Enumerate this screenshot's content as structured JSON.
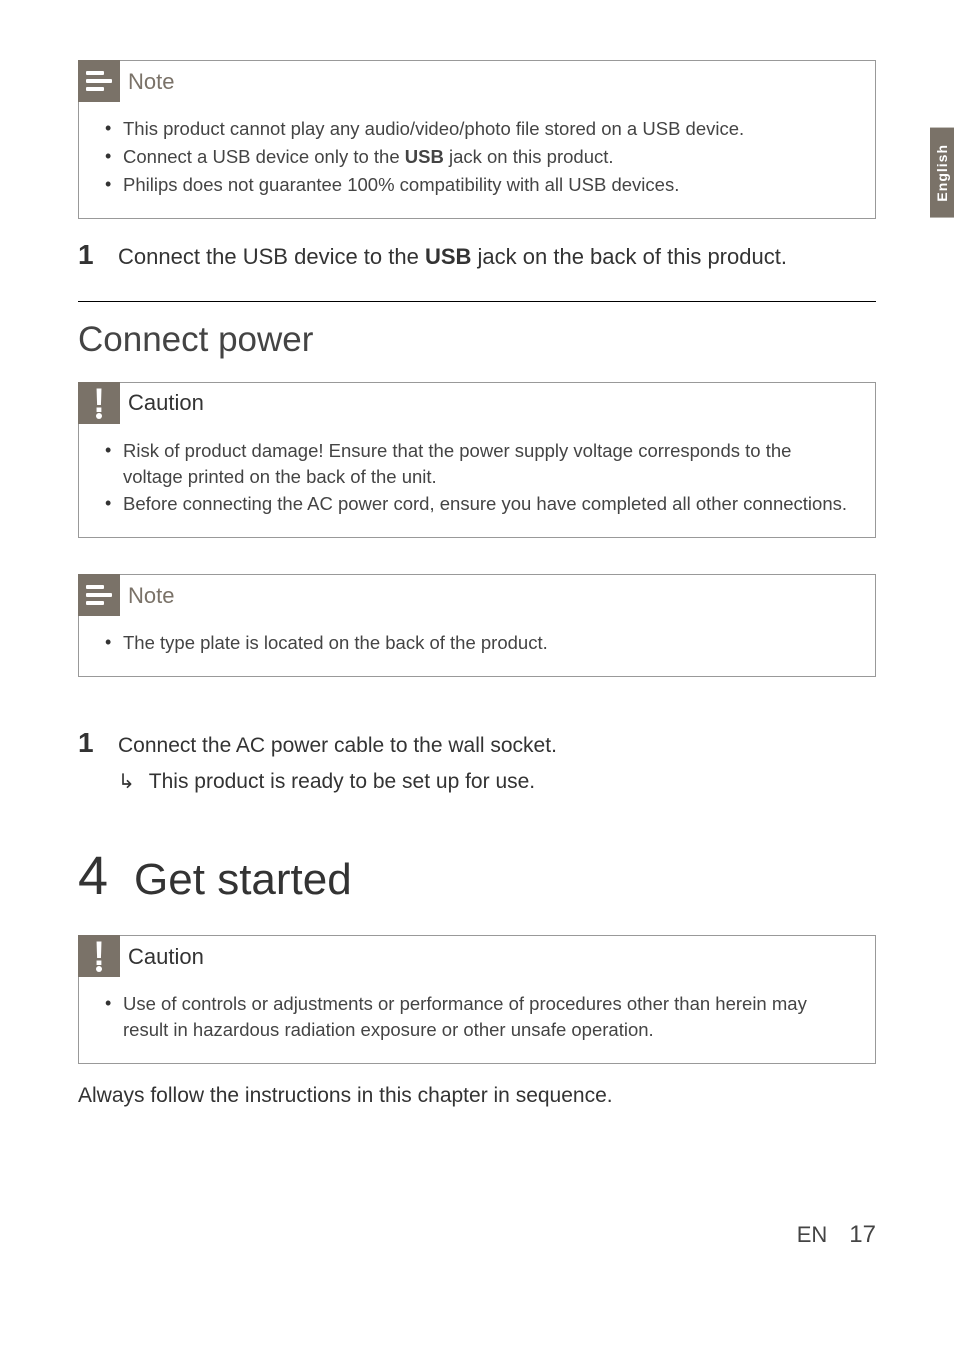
{
  "sideTab": "English",
  "boxes": {
    "note1": {
      "title": "Note",
      "items": {
        "i0_a": "This product cannot play any audio/video/photo file stored on a USB device.",
        "i1_a": "Connect a USB device only to the ",
        "i1_b": "USB",
        "i1_c": " jack on this product.",
        "i2_a": "Philips does not guarantee 100% compatibility with all USB devices."
      }
    },
    "caution1": {
      "title": "Caution",
      "items": {
        "i0_a": "Risk of product damage! Ensure that the power supply voltage corresponds to the voltage printed on the back of the unit.",
        "i1_a": "Before connecting the AC power cord, ensure you have completed all other connections."
      }
    },
    "note2": {
      "title": "Note",
      "items": {
        "i0_a": "The type plate is located on the back of the product."
      }
    },
    "caution2": {
      "title": "Caution",
      "items": {
        "i0_a": "Use of controls or adjustments or performance of procedures other than herein may result in hazardous radiation exposure or other unsafe operation."
      }
    }
  },
  "steps": {
    "s1": {
      "num": "1",
      "t_a": "Connect the USB device to the ",
      "t_b": "USB",
      "t_c": " jack on the back of this product."
    },
    "s2": {
      "num": "1",
      "t_a": "Connect the AC power cable to the wall socket.",
      "sub_a": "This product is ready to be set up for use."
    }
  },
  "headings": {
    "connectPower": "Connect power",
    "chapterNum": "4",
    "chapterTitle": "Get started"
  },
  "paragraphs": {
    "followInstr": "Always follow the instructions in this chapter in sequence."
  },
  "footer": {
    "lang": "EN",
    "page": "17"
  }
}
